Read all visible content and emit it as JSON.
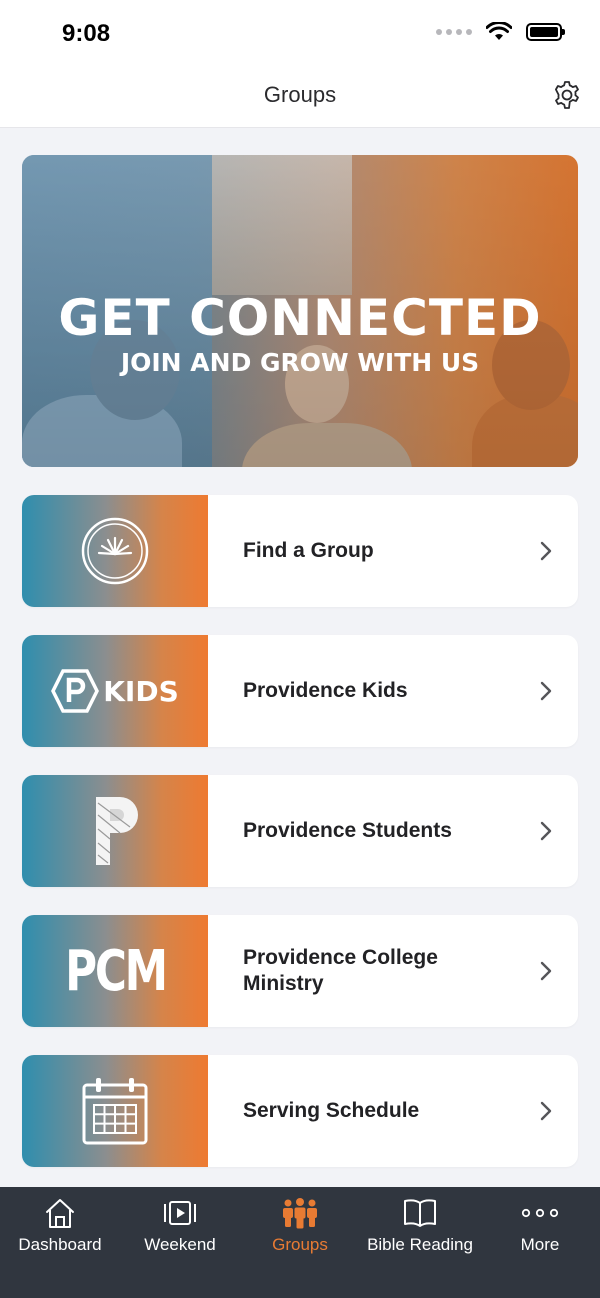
{
  "status_bar": {
    "time": "9:08"
  },
  "nav": {
    "title": "Groups"
  },
  "banner": {
    "title": "GET CONNECTED",
    "subtitle": "JOIN AND GROW WITH US"
  },
  "cards": [
    {
      "label": "Find a Group",
      "icon": "gauge-logo-icon"
    },
    {
      "label": "Providence Kids",
      "icon": "p-kids-logo-icon",
      "logo_text": "KIDS"
    },
    {
      "label": "Providence Students",
      "icon": "p-students-logo-icon"
    },
    {
      "label": "Providence College Ministry",
      "icon": "pcm-logo-icon",
      "logo_text": "PCM"
    },
    {
      "label": "Serving Schedule",
      "icon": "calendar-icon"
    }
  ],
  "tabs": [
    {
      "label": "Dashboard",
      "icon": "home-icon",
      "active": false
    },
    {
      "label": "Weekend",
      "icon": "video-play-icon",
      "active": false
    },
    {
      "label": "Groups",
      "icon": "people-icon",
      "active": true
    },
    {
      "label": "Bible Reading",
      "icon": "open-book-icon",
      "active": false
    },
    {
      "label": "More",
      "icon": "more-dots-icon",
      "active": false
    }
  ],
  "colors": {
    "accent": "#e87b33",
    "tab_bar": "#30363f",
    "gradient_start": "#2f8eae",
    "gradient_end": "#ee7a31"
  }
}
